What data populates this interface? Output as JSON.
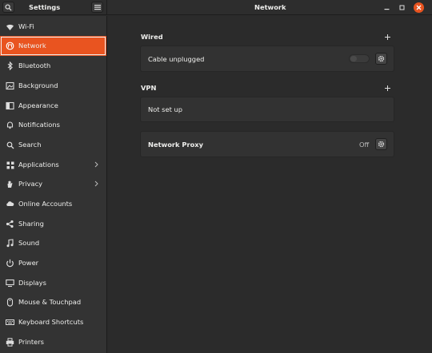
{
  "window": {
    "title": "Network"
  },
  "sidebar_header": {
    "title": "Settings"
  },
  "colors": {
    "accent": "#e95420",
    "background": "#2b2b2b",
    "sidebar": "#333333"
  },
  "sidebar": {
    "items": [
      {
        "label": "Wi-Fi",
        "icon": "wifi-icon"
      },
      {
        "label": "Network",
        "icon": "network-icon"
      },
      {
        "label": "Bluetooth",
        "icon": "bluetooth-icon"
      },
      {
        "label": "Background",
        "icon": "background-icon"
      },
      {
        "label": "Appearance",
        "icon": "appearance-icon"
      },
      {
        "label": "Notifications",
        "icon": "bell-icon"
      },
      {
        "label": "Search",
        "icon": "search-icon"
      },
      {
        "label": "Applications",
        "icon": "apps-icon"
      },
      {
        "label": "Privacy",
        "icon": "hand-icon"
      },
      {
        "label": "Online Accounts",
        "icon": "cloud-icon"
      },
      {
        "label": "Sharing",
        "icon": "share-icon"
      },
      {
        "label": "Sound",
        "icon": "music-note-icon"
      },
      {
        "label": "Power",
        "icon": "power-icon"
      },
      {
        "label": "Displays",
        "icon": "display-icon"
      },
      {
        "label": "Mouse & Touchpad",
        "icon": "mouse-icon"
      },
      {
        "label": "Keyboard Shortcuts",
        "icon": "keyboard-icon"
      },
      {
        "label": "Printers",
        "icon": "printer-icon"
      }
    ]
  },
  "main": {
    "wired": {
      "title": "Wired",
      "row_label": "Cable unplugged"
    },
    "vpn": {
      "title": "VPN",
      "row_label": "Not set up"
    },
    "proxy": {
      "label": "Network Proxy",
      "status": "Off"
    }
  }
}
